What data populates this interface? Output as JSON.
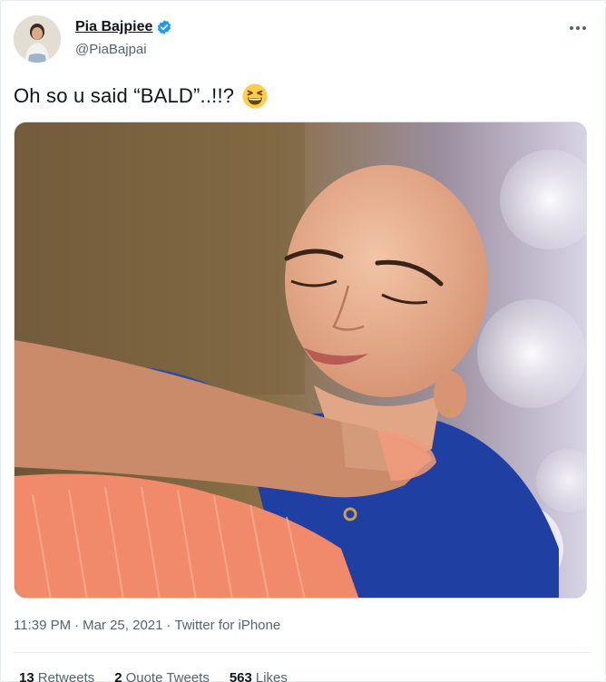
{
  "tweet": {
    "author": {
      "display_name": "Pia Bajpiee",
      "handle": "@PiaBajpai",
      "verified": true,
      "avatar_icon": "profile-photo"
    },
    "text": "Oh so u said “BALD”..!!?",
    "emoji": "grinning-squinting-face",
    "media": {
      "type": "photo",
      "description_icon": "photo"
    },
    "time": "11:39 PM",
    "date": "Mar 25, 2021",
    "source": "Twitter for iPhone",
    "stats": {
      "retweets_count": "13",
      "retweets_label": "Retweets",
      "quote_count": "2",
      "quote_label": "Quote Tweets",
      "likes_count": "563",
      "likes_label": "Likes"
    }
  },
  "colors": {
    "text_primary": "#0f1419",
    "text_secondary": "#536471",
    "verified_blue": "#1d9bf0",
    "border": "#e6ecf0"
  }
}
